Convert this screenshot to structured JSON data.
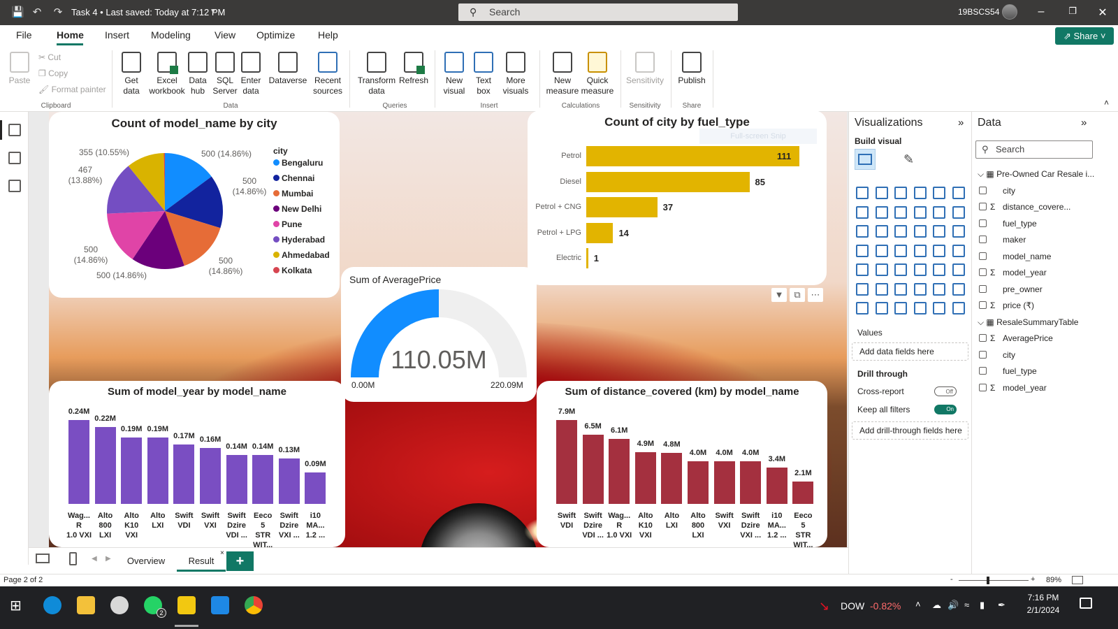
{
  "titlebar": {
    "doc_title": "Task 4 • Last saved: Today at 7:12 PM",
    "search_placeholder": "Search",
    "user": "19BSCS54"
  },
  "menu": {
    "items": [
      "File",
      "Home",
      "Insert",
      "Modeling",
      "View",
      "Optimize",
      "Help"
    ],
    "share_label": "Share"
  },
  "ribbon": {
    "clipboard": {
      "paste": "Paste",
      "cut": "Cut",
      "copy": "Copy",
      "format_painter": "Format painter",
      "group": "Clipboard"
    },
    "data": {
      "get_data": "Get data",
      "excel": "Excel workbook",
      "data_hub": "Data hub",
      "sql": "SQL Server",
      "enter_data": "Enter data",
      "dataverse": "Dataverse",
      "recent_sources": "Recent sources",
      "group": "Data"
    },
    "queries": {
      "transform": "Transform data",
      "refresh": "Refresh",
      "group": "Queries"
    },
    "insert": {
      "new_visual": "New visual",
      "text_box": "Text box",
      "more_visuals": "More visuals",
      "group": "Insert"
    },
    "calculations": {
      "new_measure": "New measure",
      "quick_measure": "Quick measure",
      "group": "Calculations"
    },
    "sensitivity": {
      "label": "Sensitivity",
      "group": "Sensitivity"
    },
    "share": {
      "publish": "Publish",
      "group": "Share"
    }
  },
  "pie": {
    "title": "Count of model_name by city",
    "legend_title": "city",
    "labels": [
      "500 (14.86%)",
      "500 (14.86%)",
      "500 (14.86%)",
      "500 (14.86%)",
      "500 (14.86%)",
      "467 (13.88%)",
      "355 (10.55%)"
    ]
  },
  "fuel": {
    "title": "Count of city by fuel_type",
    "ghost_text": "Full-screen Snip"
  },
  "gauge": {
    "title": "Sum of AveragePrice",
    "value_label": "110.05M",
    "min_label": "0.00M",
    "max_label": "220.09M",
    "fraction": 0.5
  },
  "year_chart": {
    "title": "Sum of model_year by model_name"
  },
  "dist_chart": {
    "title": "Sum of distance_covered (km) by model_name"
  },
  "chart_data": [
    {
      "type": "pie",
      "title": "Count of model_name by city",
      "legend": "right",
      "categories": [
        "Bengaluru",
        "Chennai",
        "Mumbai",
        "New Delhi",
        "Pune",
        "Hyderabad",
        "Ahmedabad",
        "Kolkata"
      ],
      "values": [
        500,
        500,
        500,
        500,
        500,
        500,
        355,
        10
      ],
      "colors": [
        "#118dff",
        "#12239e",
        "#e66c37",
        "#6b007b",
        "#e044a7",
        "#744ec2",
        "#d9b300",
        "#d64550"
      ]
    },
    {
      "type": "bar",
      "orientation": "horizontal",
      "title": "Count of city by fuel_type",
      "categories": [
        "Petrol",
        "Diesel",
        "Petrol + CNG",
        "Petrol + LPG",
        "Electric"
      ],
      "values": [
        111,
        85,
        37,
        14,
        1
      ],
      "color": "#e2b400"
    },
    {
      "type": "bar",
      "title": "Sum of model_year by model_name",
      "categories": [
        "Wag... R 1.0 VXI",
        "Alto 800 LXI",
        "Alto K10 VXI",
        "Alto LXI",
        "Swift VDI",
        "Swift VXI",
        "Swift Dzire VDI ...",
        "Eeco 5 STR WIT...",
        "Swift Dzire VXI ...",
        "i10 MA... 1.2 ..."
      ],
      "values": [
        0.24,
        0.22,
        0.19,
        0.19,
        0.17,
        0.16,
        0.14,
        0.14,
        0.13,
        0.09
      ],
      "labels": [
        "0.24M",
        "0.22M",
        "0.19M",
        "0.19M",
        "0.17M",
        "0.16M",
        "0.14M",
        "0.14M",
        "0.13M",
        "0.09M"
      ],
      "ylim": [
        0,
        0.24
      ],
      "color": "#7a4ec2"
    },
    {
      "type": "bar",
      "title": "Sum of distance_covered (km) by model_name",
      "categories": [
        "Swift VDI",
        "Swift Dzire VDI ...",
        "Wag... R 1.0 VXI",
        "Alto K10 VXI",
        "Alto LXI",
        "Alto 800 LXI",
        "Swift VXI",
        "Swift Dzire VXI ...",
        "i10 MA... 1.2 ...",
        "Eeco 5 STR WIT..."
      ],
      "values": [
        7.9,
        6.5,
        6.1,
        4.9,
        4.8,
        4.0,
        4.0,
        4.0,
        3.4,
        2.1
      ],
      "labels": [
        "7.9M",
        "6.5M",
        "6.1M",
        "4.9M",
        "4.8M",
        "4.0M",
        "4.0M",
        "4.0M",
        "3.4M",
        "2.1M"
      ],
      "ylim": [
        0,
        7.9
      ],
      "color": "#a4303f"
    }
  ],
  "pages": {
    "tabs": [
      "Overview",
      "Result"
    ],
    "active": "Result",
    "status": "Page 2 of 2",
    "zoom": "89%"
  },
  "viz_pane": {
    "title": "Visualizations",
    "build_visual": "Build visual",
    "values_label": "Values",
    "values_placeholder": "Add data fields here",
    "drill_through": "Drill through",
    "cross_report": "Cross-report",
    "cross_report_state": "Off",
    "keep_filters": "Keep all filters",
    "keep_filters_state": "On",
    "drill_placeholder": "Add drill-through fields here"
  },
  "data_pane": {
    "title": "Data",
    "search_placeholder": "Search",
    "tables": [
      {
        "name": "Pre-Owned Car Resale i...",
        "fields": [
          "city",
          "distance_covere...",
          "fuel_type",
          "maker",
          "model_name",
          "model_year",
          "pre_owner",
          "price (₹)"
        ],
        "sigma": [
          false,
          true,
          false,
          false,
          false,
          true,
          false,
          true
        ]
      },
      {
        "name": "ResaleSummaryTable",
        "fields": [
          "AveragePrice",
          "city",
          "fuel_type",
          "model_year"
        ],
        "sigma": [
          true,
          false,
          false,
          true
        ]
      }
    ]
  },
  "taskbar": {
    "ticker": "DOW",
    "change": "-0.82%",
    "time": "7:16 PM",
    "date": "2/1/2024",
    "whatsapp_badge": "2"
  }
}
